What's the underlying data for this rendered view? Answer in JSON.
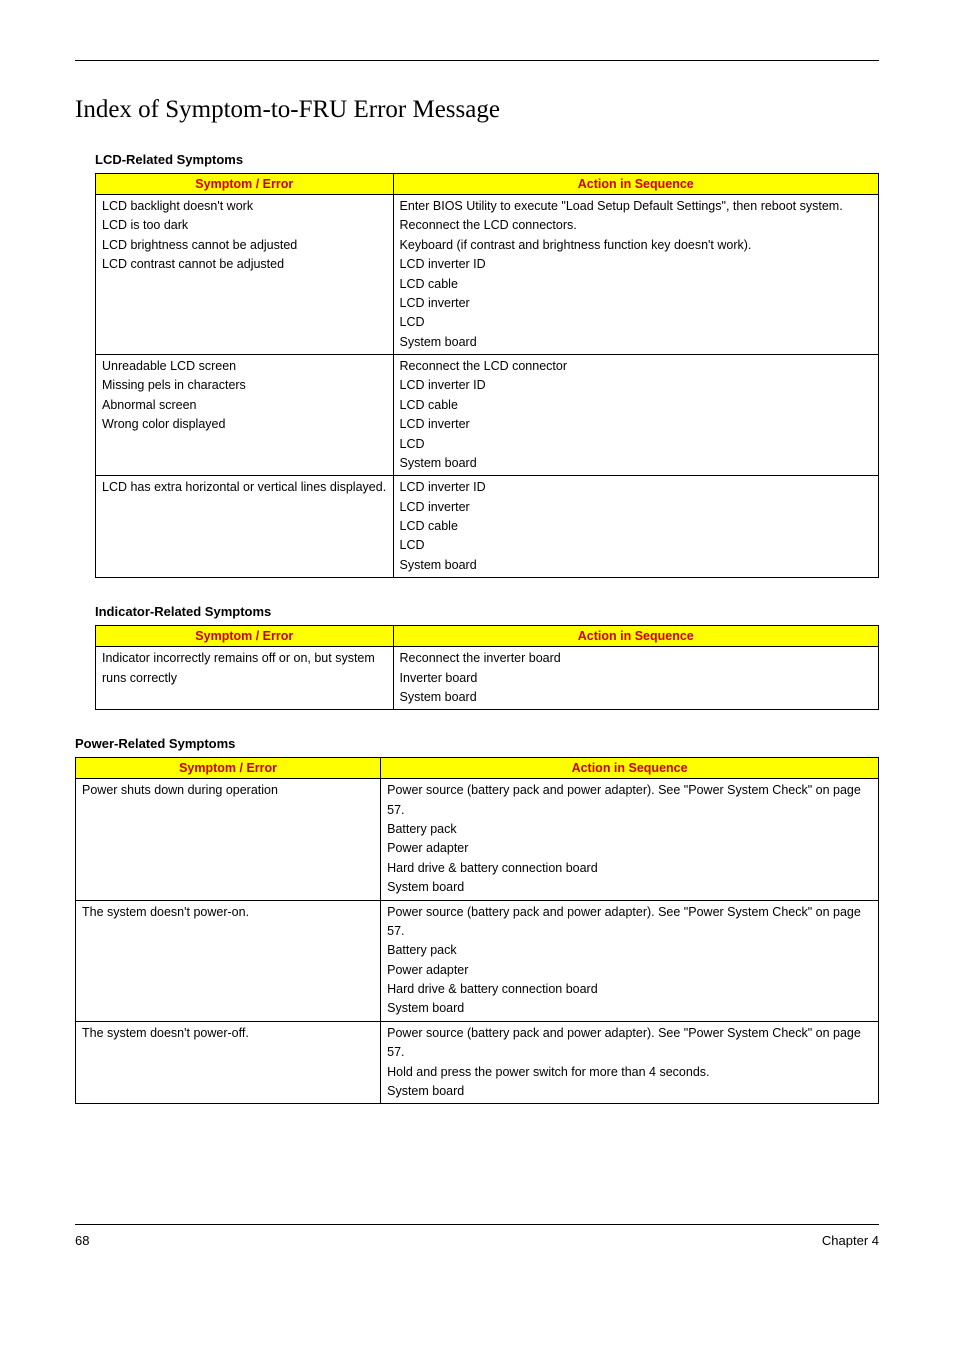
{
  "page_title": "Index of Symptom-to-FRU Error Message",
  "sections": {
    "lcd": {
      "heading": "LCD-Related Symptoms",
      "col_symptom": "Symptom / Error",
      "col_action": "Action in Sequence",
      "rows": {
        "r1": {
          "symptom": {
            "l1": "LCD backlight doesn't work",
            "l2": "LCD is too dark",
            "l3": "LCD brightness cannot be adjusted",
            "l4": "LCD contrast cannot be adjusted"
          },
          "actions": {
            "a1": "Enter BIOS Utility to execute \"Load Setup Default Settings\", then reboot system.",
            "a2": "Reconnect the LCD connectors.",
            "a3": "Keyboard (if contrast and brightness function key doesn't work).",
            "a4": "LCD inverter ID",
            "a5": "LCD cable",
            "a6": "LCD inverter",
            "a7": "LCD",
            "a8": "System board"
          }
        },
        "r2": {
          "symptom": {
            "l1": "Unreadable LCD screen",
            "l2": "Missing pels in characters",
            "l3": "Abnormal screen",
            "l4": "Wrong color displayed"
          },
          "actions": {
            "a1": "Reconnect the LCD connector",
            "a2": "LCD inverter ID",
            "a3": "LCD cable",
            "a4": "LCD inverter",
            "a5": "LCD",
            "a6": "System board"
          }
        },
        "r3": {
          "symptom": {
            "l1": "LCD has extra horizontal or vertical lines displayed."
          },
          "actions": {
            "a1": "LCD inverter ID",
            "a2": "LCD inverter",
            "a3": "LCD cable",
            "a4": "LCD",
            "a5": "System board"
          }
        }
      }
    },
    "indicator": {
      "heading": "Indicator-Related Symptoms",
      "col_symptom": "Symptom / Error",
      "col_action": "Action in Sequence",
      "rows": {
        "r1": {
          "symptom": {
            "l1": "Indicator incorrectly remains off or on, but system runs correctly"
          },
          "actions": {
            "a1": "Reconnect the inverter board",
            "a2": "Inverter board",
            "a3": "System board"
          }
        }
      }
    },
    "power": {
      "heading": "Power-Related Symptoms",
      "col_symptom": "Symptom / Error",
      "col_action": "Action in Sequence",
      "rows": {
        "r1": {
          "symptom": {
            "l1": "Power shuts down during operation"
          },
          "actions": {
            "a1": "Power source (battery pack and power adapter). See \"Power System Check\" on page 57.",
            "a2": "Battery pack",
            "a3": "Power adapter",
            "a4": "Hard drive & battery connection board",
            "a5": "System board"
          }
        },
        "r2": {
          "symptom": {
            "l1": "The system doesn't power-on."
          },
          "actions": {
            "a1": "Power source (battery pack and power adapter). See \"Power System Check\" on page 57.",
            "a2": "Battery pack",
            "a3": "Power adapter",
            "a4": "Hard drive & battery connection board",
            "a5": "System board"
          }
        },
        "r3": {
          "symptom": {
            "l1": "The system doesn't power-off."
          },
          "actions": {
            "a1": "Power source (battery pack and power adapter). See \"Power System Check\" on page 57.",
            "a2": "Hold and press the power switch for more than 4 seconds.",
            "a3": "System board"
          }
        }
      }
    }
  },
  "footer": {
    "page_number": "68",
    "chapter": "Chapter 4"
  }
}
